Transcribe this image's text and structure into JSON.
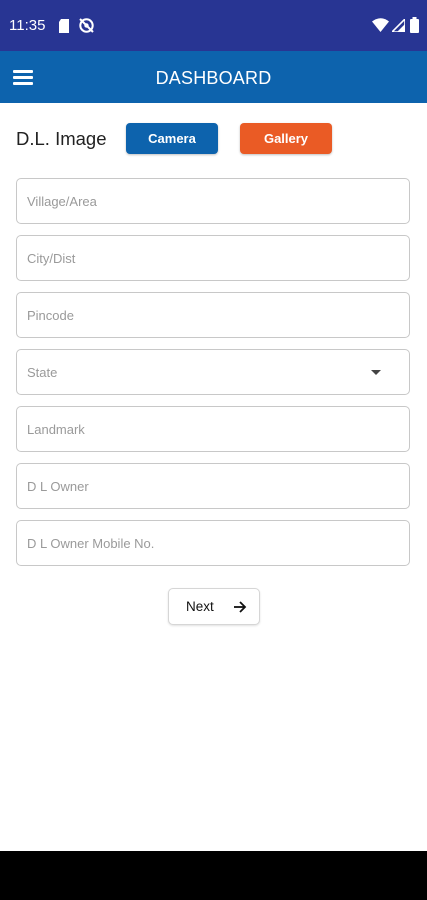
{
  "status_bar": {
    "time": "11:35",
    "background": "#283593",
    "left_icons": [
      "sd-card-icon",
      "no-sync-icon"
    ],
    "right_icons": [
      "wifi-icon",
      "cellular-signal-icon",
      "battery-icon"
    ]
  },
  "app_bar": {
    "title": "DASHBOARD",
    "menu_icon": "hamburger-menu-icon",
    "background": "#0d63ad"
  },
  "dl_image": {
    "label": "D.L. Image",
    "camera_label": "Camera",
    "gallery_label": "Gallery",
    "camera_color": "#0d63ad",
    "gallery_color": "#ea5b25"
  },
  "form": {
    "village_placeholder": "Village/Area",
    "city_placeholder": "City/Dist",
    "pincode_placeholder": "Pincode",
    "state_placeholder": "State",
    "landmark_placeholder": "Landmark",
    "dl_owner_placeholder": "D L Owner",
    "dl_owner_mobile_placeholder": "D L Owner Mobile No."
  },
  "next_button": {
    "label": "Next",
    "icon": "arrow-right-icon"
  }
}
